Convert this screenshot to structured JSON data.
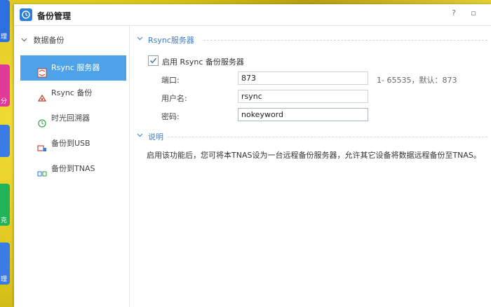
{
  "window": {
    "title": "备份管理",
    "help_glyph": "?",
    "minimize_glyph": "▫"
  },
  "dock": {
    "tiles": [
      {
        "glyph": "理",
        "color": "#2c6fe0"
      },
      {
        "glyph": "分",
        "color": "#e13a9a"
      },
      {
        "glyph": "",
        "color": "#3b7be6"
      },
      {
        "glyph": "克",
        "color": "#22b35a"
      },
      {
        "glyph": "理",
        "color": "#3b7be6"
      }
    ]
  },
  "sidebar": {
    "group_label": "数据备份",
    "items": [
      {
        "label": "Rsync 服务器",
        "icon": "rsync-server-icon",
        "active": true
      },
      {
        "label": "Rsync 备份",
        "icon": "rsync-backup-icon",
        "active": false
      },
      {
        "label": "时光回溯器",
        "icon": "time-machine-icon",
        "active": false
      },
      {
        "label": "备份到USB",
        "icon": "usb-backup-icon",
        "active": false
      },
      {
        "label": "备份到TNAS",
        "icon": "tnas-backup-icon",
        "active": false
      }
    ]
  },
  "main": {
    "section_title": "Rsync服务器",
    "enable_label": "启用 Rsync 备份服务器",
    "enable_checked": true,
    "fields": {
      "port": {
        "label": "端口:",
        "value": "873",
        "hint": "1- 65535，默认：873"
      },
      "username": {
        "label": "用户名:",
        "value": "rsync"
      },
      "password": {
        "label": "密码:",
        "value": "nokeyword"
      }
    },
    "desc_title": "说明",
    "desc_text": "启用该功能后，您可将本TNAS设为一台远程备份服务器，允许其它设备将数据远程备份至TNAS。"
  },
  "colors": {
    "accent": "#4ea3e8",
    "section_title": "#3a7fc8"
  }
}
